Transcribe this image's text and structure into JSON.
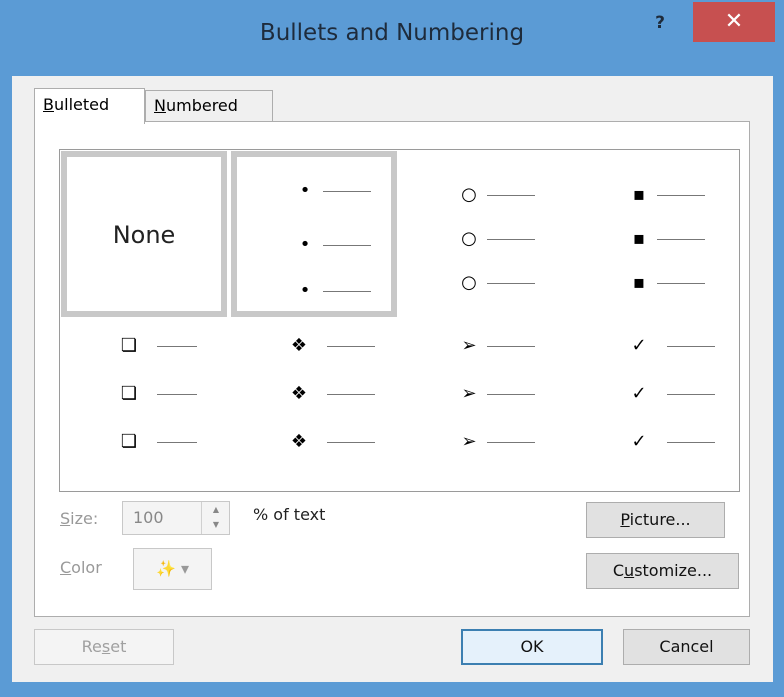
{
  "window": {
    "title": "Bullets and Numbering",
    "help_label": "?",
    "close_label": "✕"
  },
  "tabs": [
    {
      "label_underline": "B",
      "label_rest": "ulleted"
    },
    {
      "label_underline": "N",
      "label_rest": "umbered"
    }
  ],
  "gallery": {
    "none_label": "None",
    "styles": [
      {
        "bullet": "•"
      },
      {
        "bullet": "○"
      },
      {
        "bullet": "▪"
      },
      {
        "bullet": "❏"
      },
      {
        "bullet": "❖"
      },
      {
        "bullet": "➢"
      },
      {
        "bullet": "✓"
      }
    ]
  },
  "size": {
    "label_underline": "S",
    "label_rest": "ize:",
    "value": "100",
    "suffix": "% of text"
  },
  "color": {
    "label_underline": "C",
    "label_rest": "olor",
    "button_glyph": "✨ ▾"
  },
  "buttons": {
    "picture_underline": "P",
    "picture_rest": "icture...",
    "customize_pre": "C",
    "customize_underline": "u",
    "customize_rest": "stomize...",
    "reset_pre": "Re",
    "reset_underline": "s",
    "reset_rest": "et",
    "ok": "OK",
    "cancel": "Cancel"
  }
}
